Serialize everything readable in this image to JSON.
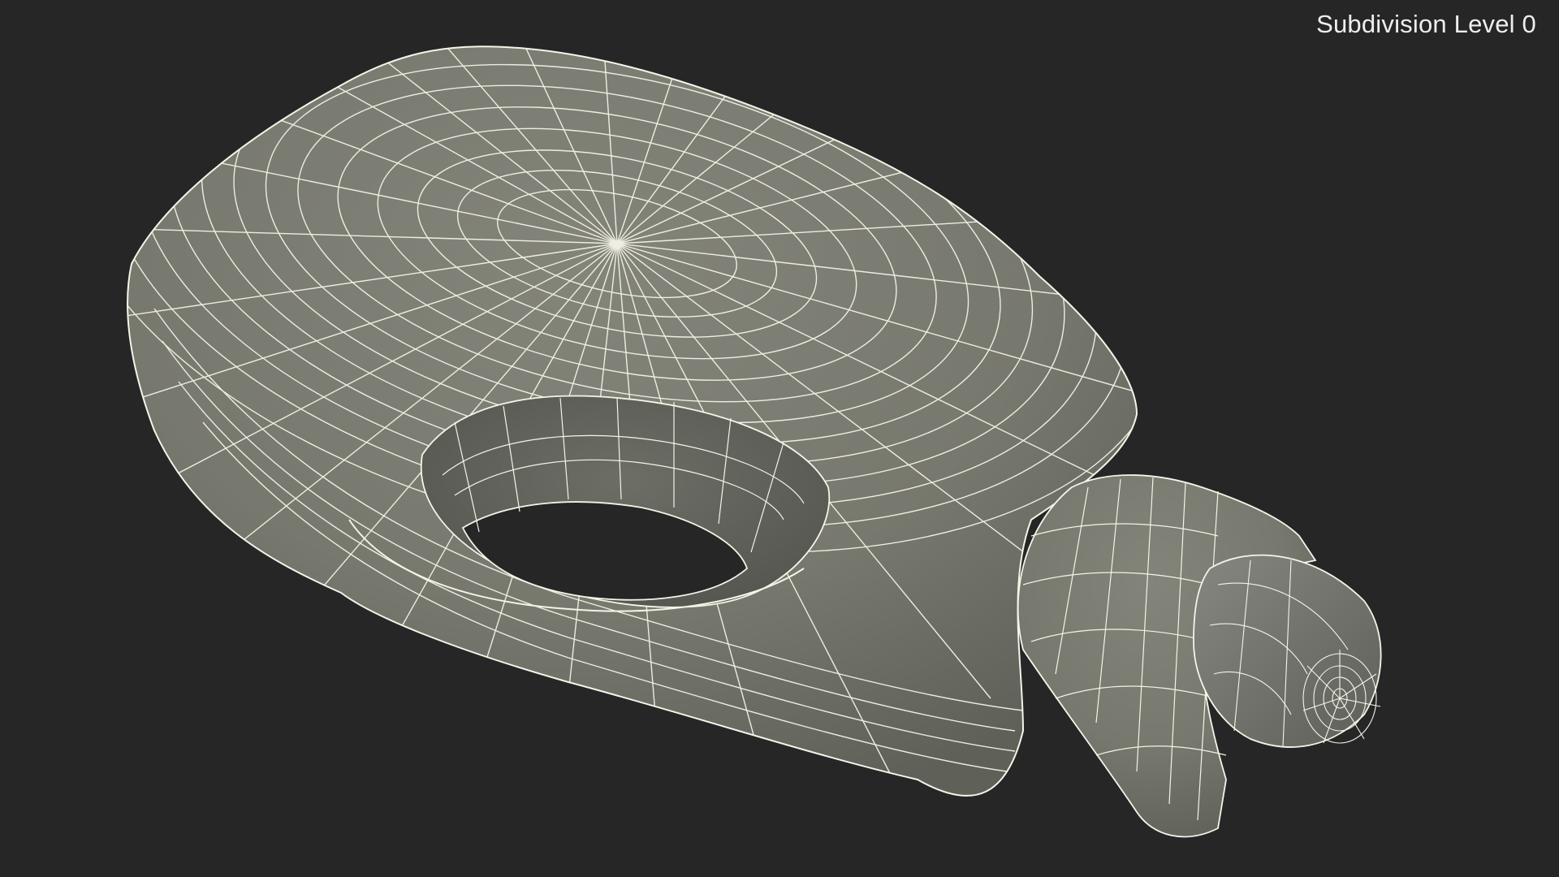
{
  "viewport": {
    "background": "#262626",
    "overlay_label": "Subdivision Level 0"
  },
  "model": {
    "icon": "wireframe-mesh",
    "surface_color": "#77786e",
    "wire_color": "#f4f4e8"
  }
}
